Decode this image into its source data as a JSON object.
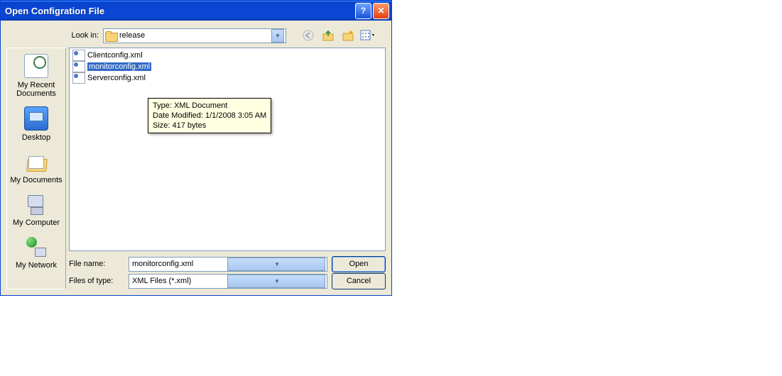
{
  "title": "Open Configration File",
  "lookin": {
    "label": "Look in:",
    "value": "release"
  },
  "places": {
    "recent": "My Recent Documents",
    "desktop": "Desktop",
    "docs": "My Documents",
    "computer": "My Computer",
    "network": "My Network"
  },
  "files": [
    {
      "name": "Clientconfig.xml",
      "selected": false
    },
    {
      "name": "monitorconfig.xml",
      "selected": true
    },
    {
      "name": "Serverconfig.xml",
      "selected": false
    }
  ],
  "tooltip": {
    "type_line": "Type: XML Document",
    "date_line": "Date Modified: 1/1/2008 3:05 AM",
    "size_line": "Size: 417 bytes"
  },
  "filename": {
    "label": "File name:",
    "value": "monitorconfig.xml"
  },
  "filetype": {
    "label": "Files of type:",
    "value": "XML Files (*.xml)"
  },
  "buttons": {
    "open": "Open",
    "cancel": "Cancel"
  }
}
